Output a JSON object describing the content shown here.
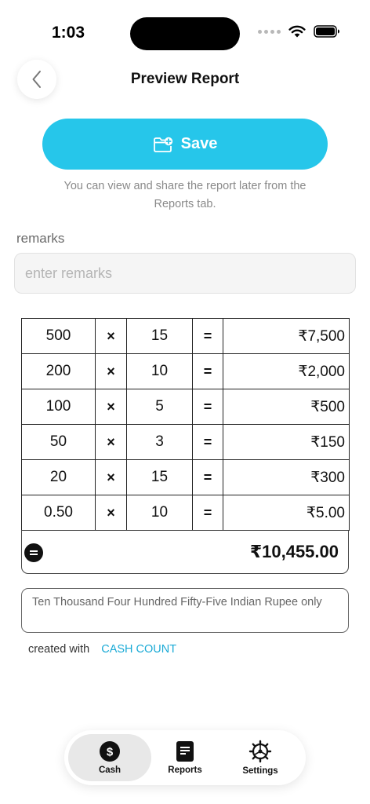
{
  "status_bar": {
    "time": "1:03"
  },
  "header": {
    "title": "Preview Report"
  },
  "save": {
    "label": "Save",
    "hint": "You can view and share the report later from the Reports tab."
  },
  "remarks": {
    "label": "remarks",
    "placeholder": "enter remarks",
    "value": ""
  },
  "rows": [
    {
      "denomination": "500",
      "times": "×",
      "count": "15",
      "equals": "=",
      "amount": "₹7,500"
    },
    {
      "denomination": "200",
      "times": "×",
      "count": "10",
      "equals": "=",
      "amount": "₹2,000"
    },
    {
      "denomination": "100",
      "times": "×",
      "count": "5",
      "equals": "=",
      "amount": "₹500"
    },
    {
      "denomination": "50",
      "times": "×",
      "count": "3",
      "equals": "=",
      "amount": "₹150"
    },
    {
      "denomination": "20",
      "times": "×",
      "count": "15",
      "equals": "=",
      "amount": "₹300"
    },
    {
      "denomination": "0.50",
      "times": "×",
      "count": "10",
      "equals": "=",
      "amount": "₹5.00"
    }
  ],
  "total": {
    "value": "₹10,455.00"
  },
  "amount_in_words": "Ten Thousand Four Hundred Fifty-Five Indian Rupee only",
  "credit": {
    "prefix": "created with",
    "brand": "CASH COUNT"
  },
  "nav": {
    "items": [
      {
        "label": "Cash",
        "icon": "dollar-circle-icon",
        "active": true
      },
      {
        "label": "Reports",
        "icon": "document-icon",
        "active": false
      },
      {
        "label": "Settings",
        "icon": "gear-icon",
        "active": false
      }
    ]
  },
  "colors": {
    "accent": "#26c6ea",
    "brand_link": "#1aaad6",
    "nav_active_bg": "#e8e8e8"
  }
}
